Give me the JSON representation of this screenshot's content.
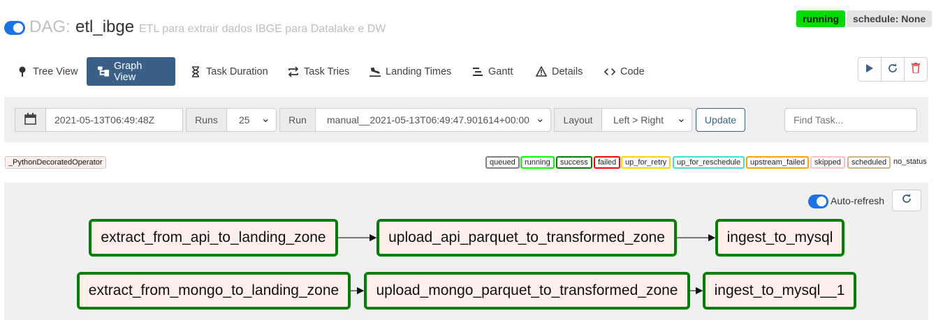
{
  "header": {
    "dag_label": "DAG:",
    "dag_id": "etl_ibge",
    "description": "ETL para extrair dados IBGE para Datalake e DW",
    "state": "running",
    "schedule": "schedule: None"
  },
  "nav": {
    "tabs": [
      {
        "label": "Tree View",
        "icon": "pin-icon"
      },
      {
        "label": "Graph View",
        "icon": "graph-icon"
      },
      {
        "label": "Task Duration",
        "icon": "hourglass-icon"
      },
      {
        "label": "Task Tries",
        "icon": "repeat-icon"
      },
      {
        "label": "Landing Times",
        "icon": "plane-landing-icon"
      },
      {
        "label": "Gantt",
        "icon": "gantt-icon"
      },
      {
        "label": "Details",
        "icon": "warning-triangle-icon"
      },
      {
        "label": "Code",
        "icon": "code-icon"
      }
    ],
    "actions": [
      "play-icon",
      "refresh-icon",
      "trash-icon"
    ]
  },
  "filters": {
    "execution_date": "2021-05-13T06:49:48Z",
    "runs_label": "Runs",
    "runs_value": "25",
    "run_label": "Run",
    "run_value": "manual__2021-05-13T06:49:47.901614+00:00",
    "layout_label": "Layout",
    "layout_value": "Left > Right",
    "update_label": "Update",
    "find_placeholder": "Find Task..."
  },
  "legend": {
    "operator": "_PythonDecoratedOperator",
    "states": [
      {
        "label": "queued",
        "color": "#808080"
      },
      {
        "label": "running",
        "color": "#00ff00"
      },
      {
        "label": "success",
        "color": "#008000"
      },
      {
        "label": "failed",
        "color": "#ff0000"
      },
      {
        "label": "up_for_retry",
        "color": "#ffd700"
      },
      {
        "label": "up_for_reschedule",
        "color": "#40e0d0"
      },
      {
        "label": "upstream_failed",
        "color": "#ffa500"
      },
      {
        "label": "skipped",
        "color": "#ffc0cb"
      },
      {
        "label": "scheduled",
        "color": "#d2b48c"
      }
    ],
    "no_status": "no_status"
  },
  "graph": {
    "auto_refresh_label": "Auto-refresh",
    "tasks": [
      "extract_from_api_to_landing_zone",
      "upload_api_parquet_to_transformed_zone",
      "ingest_to_mysql",
      "extract_from_mongo_to_landing_zone",
      "upload_mongo_parquet_to_transformed_zone",
      "ingest_to_mysql__1"
    ],
    "edges": [
      [
        0,
        1
      ],
      [
        1,
        2
      ],
      [
        3,
        4
      ],
      [
        4,
        5
      ]
    ],
    "task_state_color": "#008000",
    "task_fill_color": "#ffefeb"
  }
}
